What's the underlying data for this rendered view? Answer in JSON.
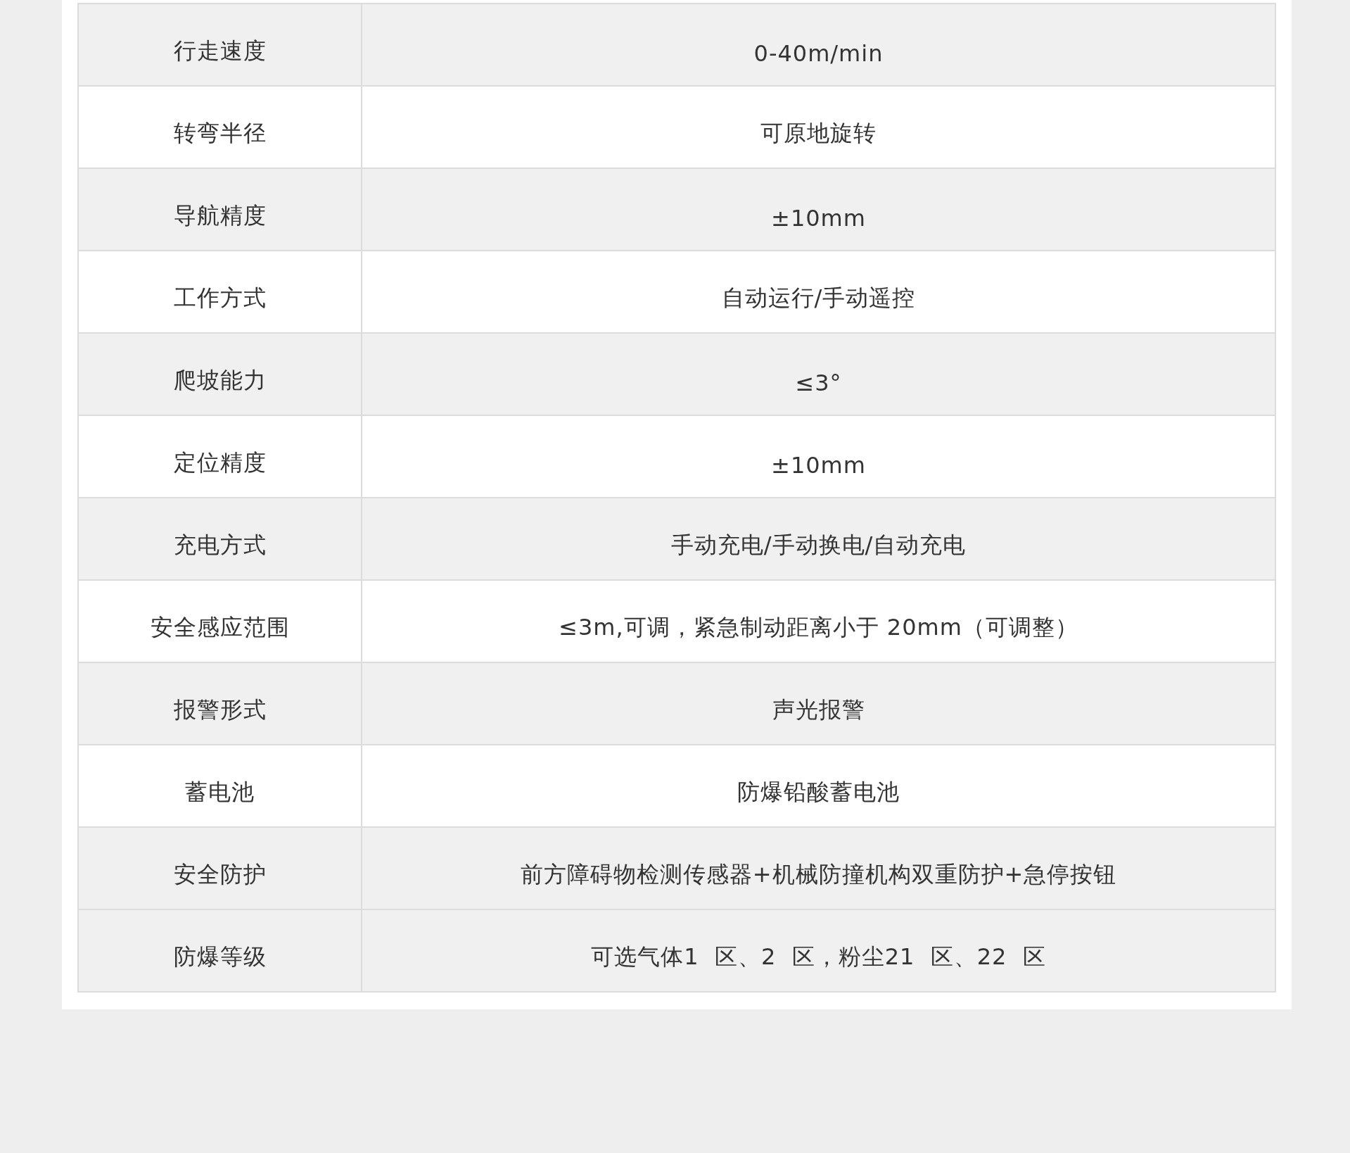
{
  "spec_table": {
    "rows": [
      {
        "label": "行走速度",
        "value": "0-40m/min",
        "shaded": true
      },
      {
        "label": "转弯半径",
        "value": "可原地旋转",
        "shaded": false
      },
      {
        "label": "导航精度",
        "value": "±10mm",
        "shaded": true
      },
      {
        "label": "工作方式",
        "value": "自动运行/手动遥控",
        "shaded": false
      },
      {
        "label": "爬坡能力",
        "value": "≤3°",
        "shaded": true
      },
      {
        "label": "定位精度",
        "value": "±10mm",
        "shaded": false
      },
      {
        "label": "充电方式",
        "value": "手动充电/手动换电/自动充电",
        "shaded": true
      },
      {
        "label": "安全感应范围",
        "value": "≤3m,可调，紧急制动距离小于 20mm（可调整）",
        "shaded": false
      },
      {
        "label": "报警形式",
        "value": "声光报警",
        "shaded": true
      },
      {
        "label": "蓄电池",
        "value": "防爆铅酸蓄电池",
        "shaded": false
      },
      {
        "label": "安全防护",
        "value": "前方障碍物检测传感器+机械防撞机构双重防护+急停按钮",
        "shaded": true
      },
      {
        "label": "防爆等级",
        "value": "可选气体1  区、2  区，粉尘21  区、22  区",
        "shaded": true
      }
    ]
  }
}
